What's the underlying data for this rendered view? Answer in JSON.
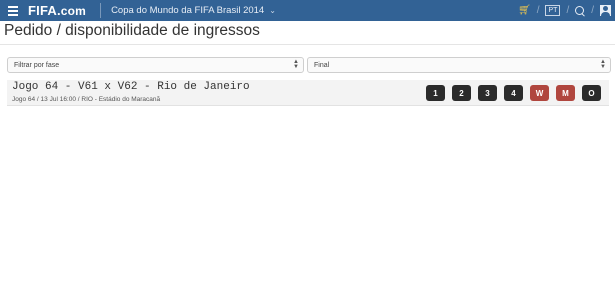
{
  "header": {
    "logo_fifa": "FIFA",
    "logo_dot": ".",
    "logo_com": "com",
    "tournament": "Copa do Mundo da FIFA Brasil 2014",
    "lang": "PT",
    "accent_color": "#326295",
    "icons": [
      "menu-icon",
      "cart-icon",
      "language-icon",
      "search-icon",
      "user-icon"
    ]
  },
  "page": {
    "title": "Pedido / disponibilidade de ingressos"
  },
  "filters": {
    "phase": "Filtrar por fase",
    "selected": "Final"
  },
  "match": {
    "title": "Jogo 64 - V61 x V62 - Rio de Janeiro",
    "subtitle": "Jogo  64  / 13 Jul 16:00 / RIO - Estádio do Maracanã",
    "categories": [
      {
        "label": "1",
        "color": "#2b2b2b"
      },
      {
        "label": "2",
        "color": "#2b2b2b"
      },
      {
        "label": "3",
        "color": "#2b2b2b"
      },
      {
        "label": "4",
        "color": "#2b2b2b"
      },
      {
        "label": "W",
        "color": "#b0463e"
      },
      {
        "label": "M",
        "color": "#b0463e"
      },
      {
        "label": "O",
        "color": "#2b2b2b"
      }
    ]
  }
}
